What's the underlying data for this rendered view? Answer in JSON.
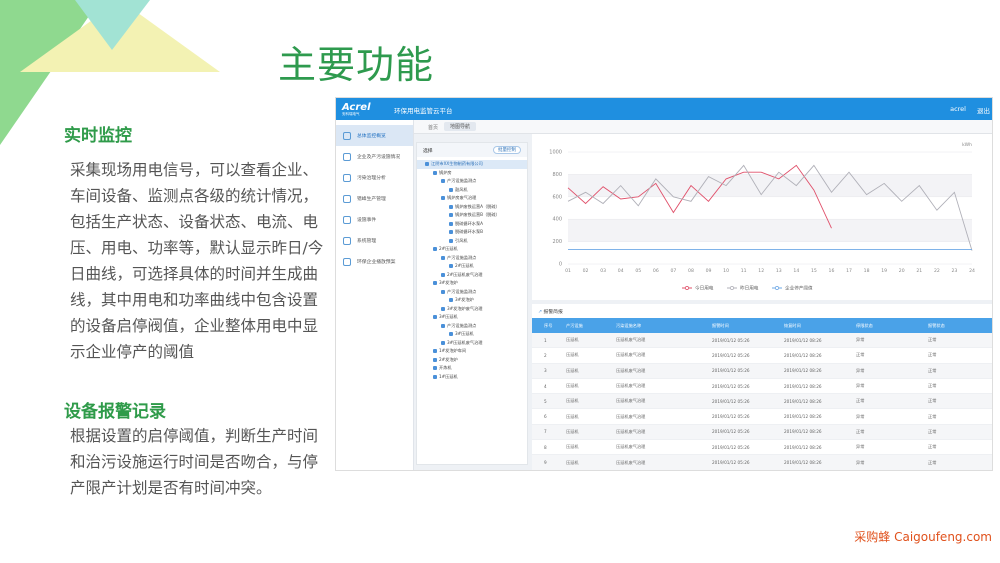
{
  "slide": {
    "heading": "主要功能",
    "section1_title": "实时监控",
    "section1_body": "采集现场用电信号，可以查看企业、车间设备、监测点各级的统计情况，包括生产状态、设备状态、电流、电压、用电、功率等，默认显示昨日/今日曲线，可选择具体的时间并生成曲线，其中用电和功率曲线中包含设置的设备启停阀值，企业整体用电中显示企业停产的阈值",
    "section2_title": "设备报警记录",
    "section2_body": "根据设置的启停阈值，判断生产时间和治污设施运行时间是否吻合，与停产限产计划是否有时间冲突。",
    "brand": "采购蜂 Caigoufeng.com",
    "colors": {
      "accent_green": "#2e9a4e",
      "tri_green": "#8fd98f",
      "tri_yellow": "#f3f2b3",
      "tri_teal": "#a2e3d4"
    }
  },
  "app": {
    "logo": "Acrel",
    "logo_sub": "安科瑞电气",
    "title": "环保用电监管云平台",
    "user": "acrel",
    "exit": "退出",
    "nav": [
      {
        "label": "总体监控概览",
        "icon": "dashboard-icon"
      },
      {
        "label": "企业及产污设施情况",
        "icon": "factory-icon"
      },
      {
        "label": "污染治理分析",
        "icon": "analysis-icon"
      },
      {
        "label": "错峰生产管理",
        "icon": "calendar-icon"
      },
      {
        "label": "设施事件",
        "icon": "event-icon"
      },
      {
        "label": "系统管理",
        "icon": "system-icon"
      },
      {
        "label": "环保企业播放预案",
        "icon": "plan-icon"
      }
    ],
    "tab_home": "首页",
    "tab_active": "地图导航",
    "tree_title": "选择",
    "tree_button": "批量控制",
    "tree": [
      {
        "label": "江阴市XX生物制药有限公司",
        "level": 0
      },
      {
        "label": "锅炉房",
        "level": 1
      },
      {
        "label": "产污设施监测点",
        "level": 2
      },
      {
        "label": "鼓风机",
        "level": 3
      },
      {
        "label": "锅炉房废气治理",
        "level": 2
      },
      {
        "label": "锅炉废铁运营A（脱硫）",
        "level": 3
      },
      {
        "label": "锅炉废铁运营B（脱硫）",
        "level": 3
      },
      {
        "label": "脱硫循环水泵A",
        "level": 3
      },
      {
        "label": "脱硫循环水泵B",
        "level": 3
      },
      {
        "label": "引风机",
        "level": 3
      },
      {
        "label": "2#压延机",
        "level": 1
      },
      {
        "label": "产污设施监测点",
        "level": 2
      },
      {
        "label": "2#压延机",
        "level": 3
      },
      {
        "label": "2#压延机废气治理",
        "level": 2
      },
      {
        "label": "3#发泡炉",
        "level": 1
      },
      {
        "label": "产污设施监测点",
        "level": 2
      },
      {
        "label": "3#发泡炉",
        "level": 3
      },
      {
        "label": "3#发泡炉废气治理",
        "level": 2
      },
      {
        "label": "3#压延机",
        "level": 1
      },
      {
        "label": "产污设施监测点",
        "level": 2
      },
      {
        "label": "3#压延机",
        "level": 3
      },
      {
        "label": "3#压延机废气治理",
        "level": 2
      },
      {
        "label": "1#发泡炉车间",
        "level": 1
      },
      {
        "label": "2#发泡炉",
        "level": 1
      },
      {
        "label": "开炼机",
        "level": 1
      },
      {
        "label": "1#压延机",
        "level": 1
      }
    ],
    "table_title": "报警简报",
    "table_headers": [
      "序号",
      "产污设施",
      "污染设施名称",
      "报警时间",
      "恢复时间",
      "停限状态",
      "报警状态"
    ],
    "table_rows": [
      [
        "1",
        "压延机",
        "压延机废气治理",
        "2019/01/12  05:26",
        "2019/01/12  08:26",
        "异常",
        "正常"
      ],
      [
        "2",
        "压延机",
        "压延机废气治理",
        "2019/01/12  05:26",
        "2019/01/12  08:26",
        "正常",
        "正常"
      ],
      [
        "3",
        "压延机",
        "压延机废气治理",
        "2019/01/12  05:26",
        "2019/01/12  08:26",
        "异常",
        "正常"
      ],
      [
        "4",
        "压延机",
        "压延机废气治理",
        "2019/01/12  05:26",
        "2019/01/12  08:26",
        "异常",
        "正常"
      ],
      [
        "5",
        "压延机",
        "压延机废气治理",
        "2019/01/12  05:26",
        "2019/01/12  08:26",
        "正常",
        "正常"
      ],
      [
        "6",
        "压延机",
        "压延机废气治理",
        "2019/01/12  05:26",
        "2019/01/12  08:26",
        "异常",
        "正常"
      ],
      [
        "7",
        "压延机",
        "压延机废气治理",
        "2019/01/12  05:26",
        "2019/01/12  08:26",
        "正常",
        "正常"
      ],
      [
        "8",
        "压延机",
        "压延机废气治理",
        "2019/01/12  05:26",
        "2019/01/12  08:26",
        "异常",
        "正常"
      ],
      [
        "9",
        "压延机",
        "压延机废气治理",
        "2019/01/12  05:26",
        "2019/01/12  08:26",
        "异常",
        "正常"
      ]
    ]
  },
  "chart_data": {
    "type": "line",
    "unit": "kWh",
    "x": [
      "01",
      "02",
      "03",
      "04",
      "05",
      "06",
      "07",
      "08",
      "09",
      "10",
      "11",
      "12",
      "13",
      "14",
      "15",
      "16",
      "17",
      "18",
      "19",
      "20",
      "21",
      "22",
      "23",
      "24"
    ],
    "yticks": [
      0,
      200,
      400,
      600,
      800,
      1000
    ],
    "ylim": [
      0,
      1000
    ],
    "series": [
      {
        "name": "今日用电",
        "color": "#e0506a",
        "values": [
          680,
          540,
          690,
          580,
          600,
          720,
          460,
          700,
          560,
          760,
          820,
          820,
          760,
          880,
          660,
          320,
          null,
          null,
          null,
          null,
          null,
          null,
          null,
          null
        ]
      },
      {
        "name": "昨日用电",
        "color": "#b0b0b8",
        "values": [
          560,
          640,
          540,
          700,
          520,
          760,
          600,
          560,
          780,
          700,
          880,
          620,
          820,
          700,
          880,
          640,
          820,
          620,
          720,
          560,
          700,
          480,
          640,
          120
        ]
      },
      {
        "name": "企业停产阈值",
        "color": "#6ea8e6",
        "values": [
          130,
          130,
          130,
          130,
          130,
          130,
          130,
          130,
          130,
          130,
          130,
          130,
          130,
          130,
          130,
          130,
          130,
          130,
          130,
          130,
          130,
          130,
          130,
          130
        ]
      }
    ],
    "legend": "bottom"
  }
}
